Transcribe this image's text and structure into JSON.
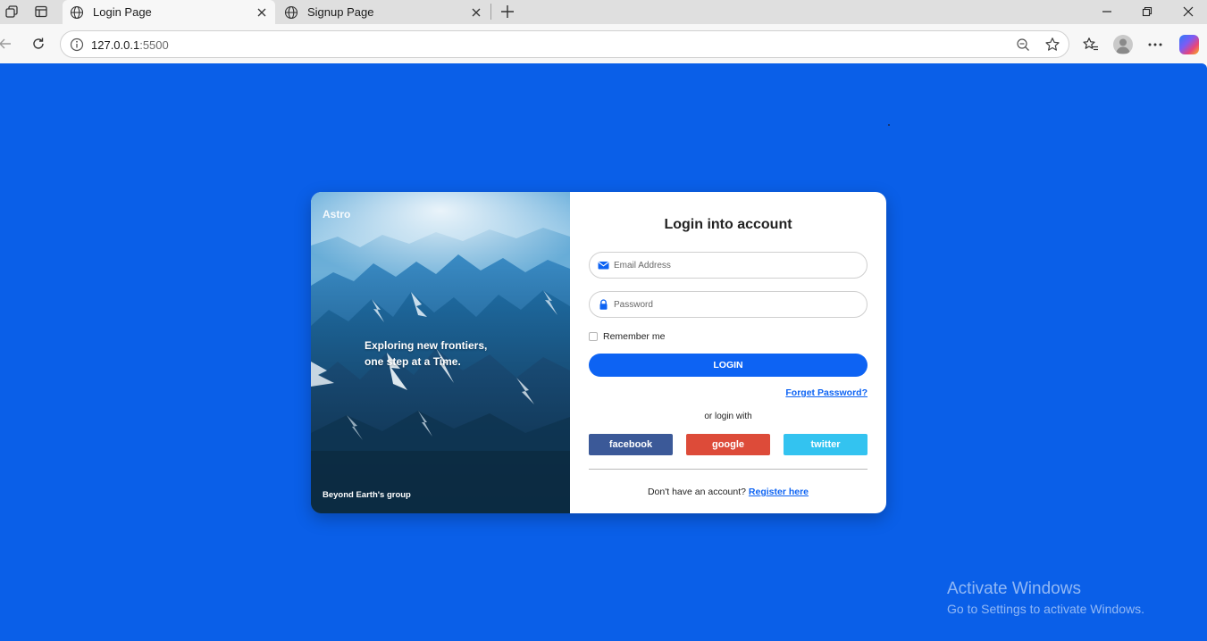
{
  "browser": {
    "tabs": [
      {
        "title": "Login Page",
        "active": true
      },
      {
        "title": "Signup Page",
        "active": false
      }
    ],
    "url_host": "127.0.0.1",
    "url_port": ":5500"
  },
  "page": {
    "background_color": "#0a5fe8",
    "hero": {
      "brand": "Astro",
      "tagline_line1": "Exploring new frontiers,",
      "tagline_line2": "one step at a Time.",
      "group": "Beyond Earth's group"
    },
    "form": {
      "heading": "Login into account",
      "email_placeholder": "Email Address",
      "password_placeholder": "Password",
      "remember_label": "Remember me",
      "login_button": "LOGIN",
      "forgot_link": "Forget Password?",
      "or_login_with": "or login with",
      "social": [
        {
          "label": "facebook",
          "color": "#3b5998"
        },
        {
          "label": "google",
          "color": "#dd4b39"
        },
        {
          "label": "twitter",
          "color": "#33c3f0"
        }
      ],
      "register_prompt": "Don't have an account?",
      "register_link": "Register here",
      "accent_color": "#0d63f3"
    }
  },
  "watermark": {
    "title": "Activate Windows",
    "subtitle": "Go to Settings to activate Windows."
  }
}
